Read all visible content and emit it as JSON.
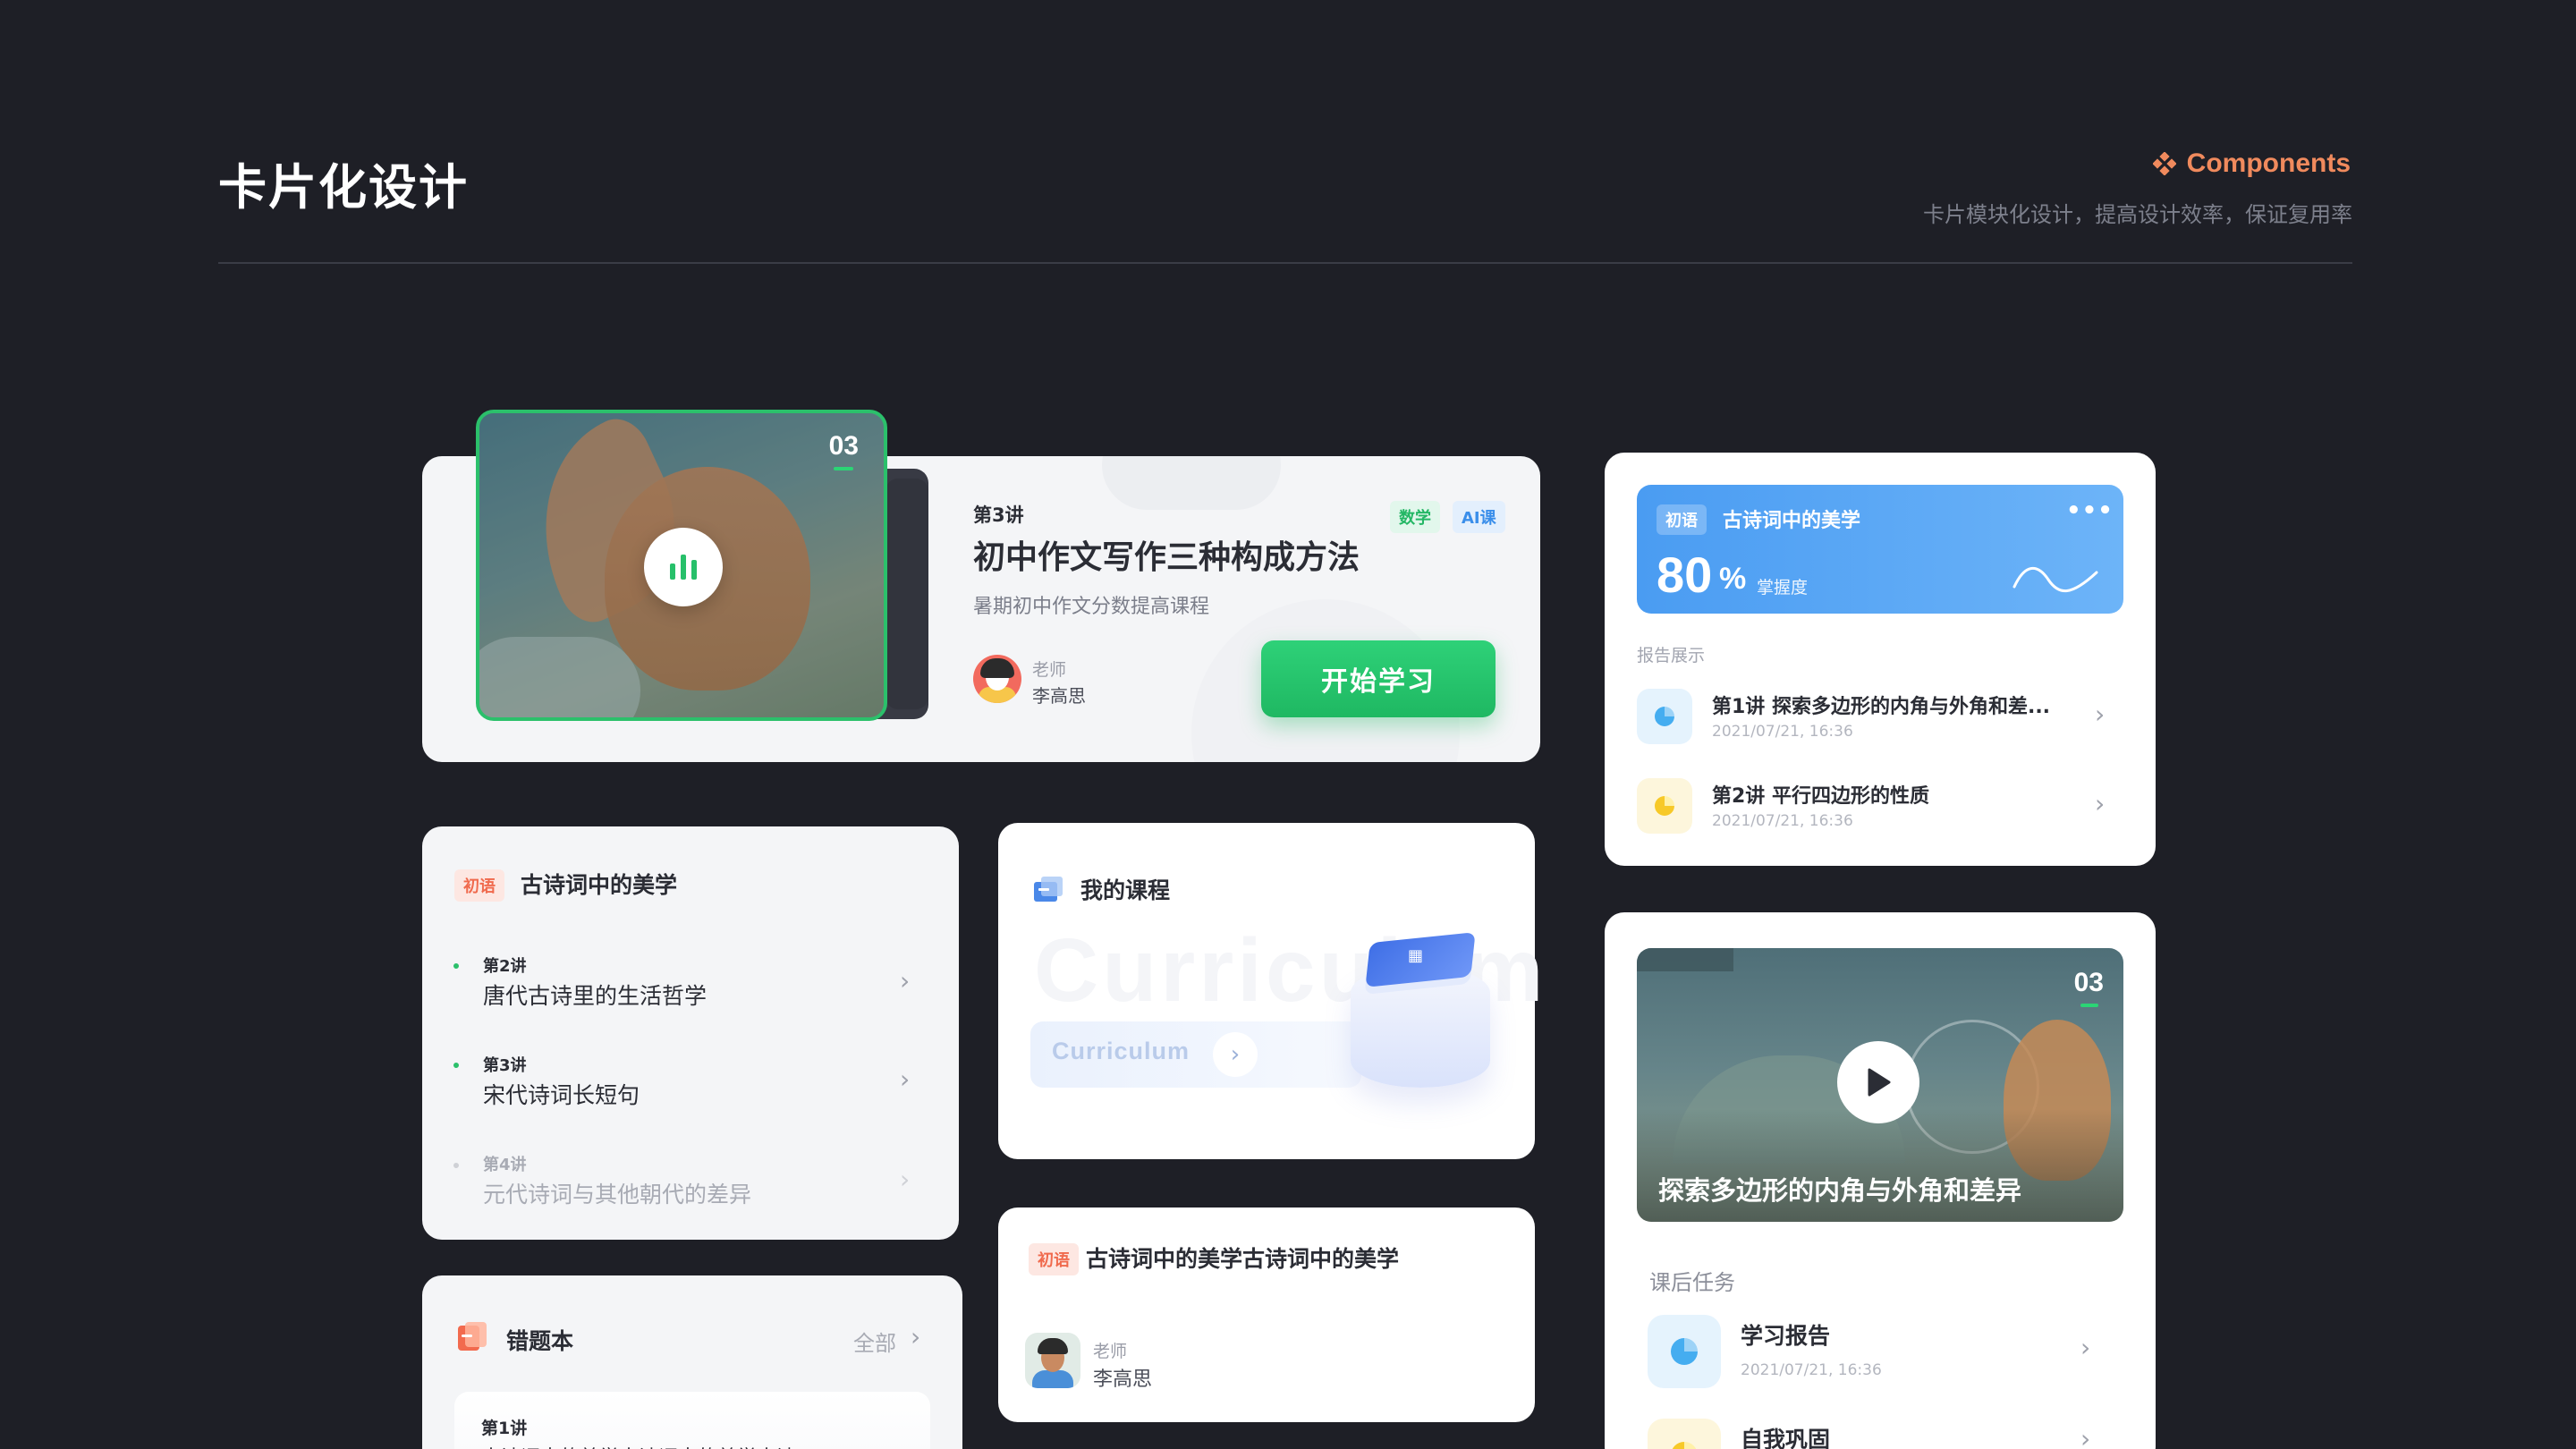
{
  "header": {
    "title": "卡片化设计",
    "section_label": "Components",
    "subtitle": "卡片模块化设计，提高设计效率，保证复用率"
  },
  "course_card": {
    "cover_number": "03",
    "lecture": "第3讲",
    "title": "初中作文写作三种构成方法",
    "subtitle": "暑期初中作文分数提高课程",
    "tags": [
      "数学",
      "AI课"
    ],
    "teacher_label": "老师",
    "teacher_name": "李高思",
    "start_button": "开始学习"
  },
  "report_card": {
    "subject": "初语",
    "title": "古诗词中的美学",
    "more": "•••",
    "score": "80",
    "percent": "%",
    "score_label": "掌握度",
    "caption": "报告展示",
    "items": [
      {
        "title": "第1讲 探索多边形的内角与外角和差...",
        "date": "2021/07/21, 16:36"
      },
      {
        "title": "第2讲 平行四边形的性质",
        "date": "2021/07/21, 16:36"
      }
    ]
  },
  "poetry_list_card": {
    "subject": "初语",
    "title": "古诗词中的美学",
    "items": [
      {
        "lecture": "第2讲",
        "text": "唐代古诗里的生活哲学"
      },
      {
        "lecture": "第3讲",
        "text": "宋代诗词长短句"
      },
      {
        "lecture": "第4讲",
        "text": "元代诗词与其他朝代的差异"
      }
    ]
  },
  "my_courses_card": {
    "title": "我的课程",
    "watermark": "Curriculum",
    "pill_text": "Curriculum"
  },
  "video_card": {
    "number": "03",
    "video_title": "探索多边形的内角与外角和差异",
    "homework_caption": "课后任务",
    "items": [
      {
        "title": "学习报告",
        "date": "2021/07/21, 16:36"
      },
      {
        "title": "自我巩固"
      }
    ]
  },
  "teacher_card": {
    "subject": "初语",
    "title": "古诗词中的美学古诗词中的美学",
    "teacher_label": "老师",
    "teacher_name": "李高思"
  },
  "mistakes_card": {
    "title": "错题本",
    "all_label": "全部",
    "lecture": "第1讲",
    "preview": "古诗词中的美学古诗词中的美学古诗"
  },
  "colors": {
    "background": "#1e1f26",
    "accent_orange": "#f08a5d",
    "primary_green": "#2bc06b",
    "report_blue": "#4a9cf2"
  }
}
